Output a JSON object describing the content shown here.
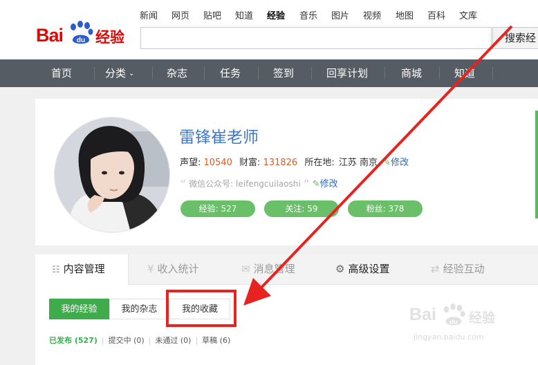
{
  "logo": {
    "bai": "Bai",
    "du": "du",
    "suffix": "经验"
  },
  "topnav": [
    {
      "label": "新闻",
      "active": false
    },
    {
      "label": "网页",
      "active": false
    },
    {
      "label": "贴吧",
      "active": false
    },
    {
      "label": "知道",
      "active": false
    },
    {
      "label": "经验",
      "active": true
    },
    {
      "label": "音乐",
      "active": false
    },
    {
      "label": "图片",
      "active": false
    },
    {
      "label": "视频",
      "active": false
    },
    {
      "label": "地图",
      "active": false
    },
    {
      "label": "百科",
      "active": false
    },
    {
      "label": "文库",
      "active": false
    }
  ],
  "search": {
    "value": "",
    "button_label": "搜索经"
  },
  "mainnav": [
    "首页",
    "分类",
    "杂志",
    "任务",
    "签到",
    "回享计划",
    "商城",
    "知道"
  ],
  "profile": {
    "name": "雷锋崔老师",
    "reputation_label": "声望:",
    "reputation": "10540",
    "wealth_label": "财富:",
    "wealth": "131826",
    "location_label": "所在地:",
    "location": "江苏 南京",
    "edit_label": "修改",
    "wechat_label": "微信公众号:",
    "wechat_value": "leifengcuilaoshi",
    "wechat_edit_label": "修改",
    "pills": [
      "经验: 527",
      "关注: 59",
      "粉丝: 378"
    ]
  },
  "tabs": [
    "内容管理",
    "收入统计",
    "消息管理",
    "高级设置",
    "经验互动"
  ],
  "subtabs": [
    "我的经验",
    "我的杂志",
    "我的收藏"
  ],
  "filters": [
    {
      "label": "已发布 (527)"
    },
    {
      "label": "提交中 (0)"
    },
    {
      "label": "未通过 (0)"
    },
    {
      "label": "草稿 (6)"
    }
  ],
  "watermark": {
    "bai": "Bai",
    "du": "du",
    "suffix": "经验",
    "url": "jingyan.baidu.com"
  },
  "colors": {
    "brand_red": "#e10601",
    "nav_bg": "#555c63",
    "accent_green": "#5cb85c",
    "annotation_red": "#e8231f",
    "link_blue": "#2a6bbd",
    "number_orange": "#e3591b"
  }
}
